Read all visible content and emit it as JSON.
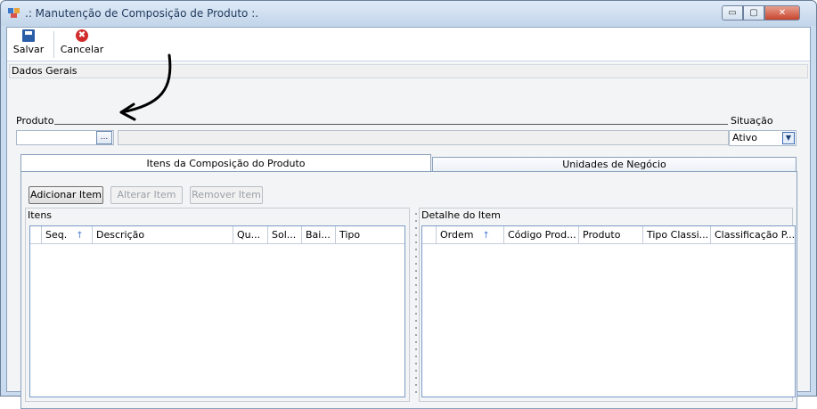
{
  "window": {
    "title": ".: Manutenção de Composição de Produto :.",
    "controls": {
      "minimize": "▭",
      "maximize": "▢",
      "close": "✕"
    }
  },
  "toolbar": {
    "save_label": "Salvar",
    "cancel_label": "Cancelar",
    "cancel_glyph": "✖"
  },
  "dados_gerais": {
    "title": "Dados Gerais",
    "produto_label": "Produto",
    "produto_value": "",
    "ellipsis": "...",
    "situacao_label": "Situação",
    "situacao_value": "Ativo",
    "select_arrow": "▼"
  },
  "tabs": [
    {
      "label": "Itens da Composição do Produto",
      "active": true
    },
    {
      "label": "Unidades de Negócio",
      "active": false
    }
  ],
  "actions": {
    "add": "Adicionar Item",
    "edit": "Alterar Item",
    "remove": "Remover Item"
  },
  "itens": {
    "title": "Itens",
    "columns": [
      "Seq.",
      "Descrição",
      "Qu...",
      "Sol...",
      "Bai...",
      "Tipo"
    ],
    "sort_glyph": "↑",
    "rows": []
  },
  "detalhe": {
    "title": "Detalhe do Item",
    "columns": [
      "Ordem",
      "Código Prod...",
      "Produto",
      "Tipo Classi...",
      "Classificação P..."
    ],
    "sort_glyph": "↑",
    "rows": []
  },
  "colors": {
    "accent": "#7a9cc6",
    "cancel_red": "#d02c2c",
    "save_blue": "#2a5fa8"
  }
}
